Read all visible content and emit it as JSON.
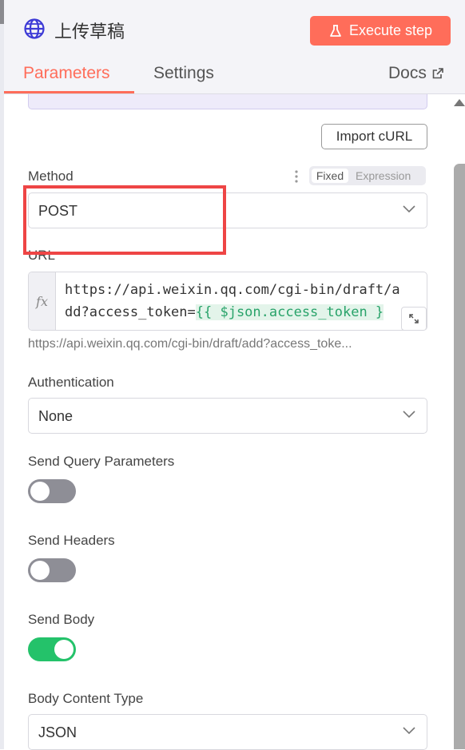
{
  "header": {
    "node_title": "上传草稿",
    "execute_label": "Execute step",
    "node_icon": "globe-icon",
    "accent_color": "#ff6d5a"
  },
  "tabs": {
    "parameters": "Parameters",
    "settings": "Settings",
    "docs": "Docs",
    "active": "Parameters"
  },
  "import_curl_label": "Import cURL",
  "method": {
    "label": "Method",
    "value": "POST",
    "mode_fixed": "Fixed",
    "mode_expression": "Expression",
    "selected_mode": "Fixed"
  },
  "url": {
    "label": "URL",
    "fx_label": "fx",
    "line1": "https://api.weixin.qq.com/cgi-bin/draft/a",
    "line2_prefix": "dd?access_token=",
    "line2_expression": "{{ $json.access_token }",
    "preview": "https://api.weixin.qq.com/cgi-bin/draft/add?access_toke..."
  },
  "authentication": {
    "label": "Authentication",
    "value": "None"
  },
  "send_query_parameters": {
    "label": "Send Query Parameters",
    "enabled": false
  },
  "send_headers": {
    "label": "Send Headers",
    "enabled": false
  },
  "send_body": {
    "label": "Send Body",
    "enabled": true,
    "on_color": "#24c26a"
  },
  "body_content_type": {
    "label": "Body Content Type",
    "value": "JSON"
  },
  "highlight_color": "#ee4545"
}
